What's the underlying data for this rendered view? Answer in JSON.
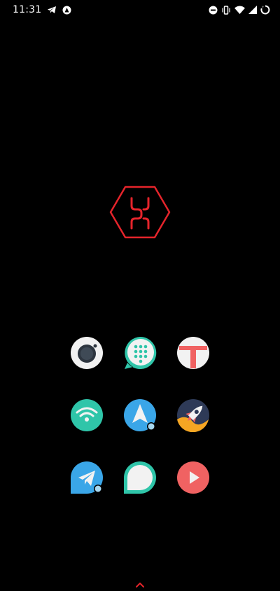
{
  "status_bar": {
    "time": "11:31",
    "left_icons": [
      "telegram-icon",
      "notification-bell-icon"
    ],
    "right_icons": [
      "do-not-disturb-icon",
      "vibrate-icon",
      "wifi-icon",
      "signal-icon",
      "battery-charging-icon"
    ]
  },
  "home": {
    "center_logo": "hexagon-x-logo",
    "accent_color": "#e5242b",
    "apps": [
      {
        "icon": "camera-icon"
      },
      {
        "icon": "dialer-icon"
      },
      {
        "icon": "t-app-icon"
      },
      {
        "icon": "wifi-app-icon"
      },
      {
        "icon": "navigation-icon"
      },
      {
        "icon": "rocket-icon"
      },
      {
        "icon": "telegram-app-icon"
      },
      {
        "icon": "messages-icon"
      },
      {
        "icon": "play-icon"
      }
    ],
    "drawer_hint_icon": "chevron-up-icon"
  }
}
